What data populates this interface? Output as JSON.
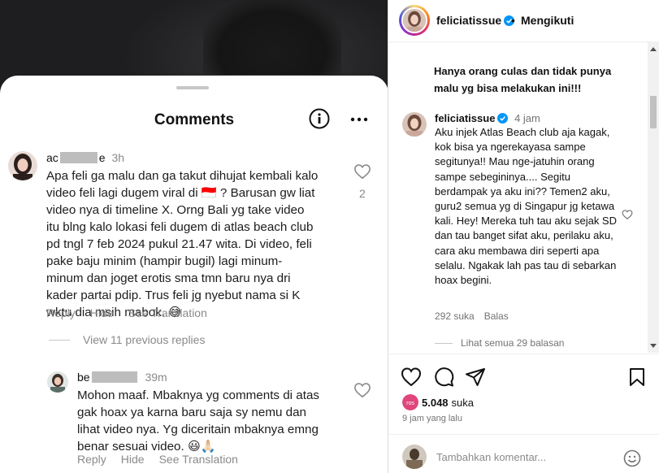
{
  "comments_sheet": {
    "title": "Comments",
    "comment1": {
      "user_prefix": "ac",
      "user_suffix": "e",
      "time": "3h",
      "text": "Apa feli ga malu dan ga takut dihujat kembali kalo\nvideo feli lagi dugem viral di 🇮🇩 ? Barusan gw liat\nvideo nya di timeline X. Orng Bali yg take video\nitu blng kalo lokasi feli dugem di atlas beach club\npd tngl 7 feb 2024 pukul 21.47 wita. Di video, feli\npake baju minim (hampir bugil) lagi minum-\nminum dan joget erotis sma tmn baru nya dri\nkader partai pdip. Trus feli jg nyebut nama si K\nwktu dia msih mabok. 😅",
      "likes": "2",
      "reply": "Reply",
      "hide": "Hide",
      "see_translation": "See Translation"
    },
    "view_replies": "View 11 previous replies",
    "comment2": {
      "user_prefix": "be",
      "user_suffix": "",
      "time": "39m",
      "text": "Mohon maaf. Mbaknya yg comments di atas\ngak hoax ya karna baru saja sy nemu dan\nlihat video nya. Yg diceritain mbaknya emng\nbenar sesuai video. 😃🙏🏻",
      "reply": "Reply",
      "hide": "Hide",
      "see_translation": "See Translation"
    }
  },
  "post": {
    "username": "feliciatissue",
    "separator": "•",
    "follow_status": "Mengikuti",
    "caption_tail": "Hanya orang culas dan tidak punya malu yg bisa melakukan ini!!!",
    "reply": {
      "username": "feliciatissue",
      "time": "4 jam",
      "text": "Aku injek Atlas Beach club aja kagak, kok bisa ya ngerekayasa sampe segitunya!! Mau nge-jatuhin orang sampe sebegininya.... Segitu berdampak ya aku ini?? Temen2 aku, guru2 semua yg di Singapur jg ketawa kali. Hey! Mereka tuh tau aku sejak SD dan tau banget sifat aku, perilaku aku, cara aku membawa diri seperti apa selalu. Ngakak lah pas tau di sebarkan hoax begini.",
      "likes": "292 suka",
      "reply_label": "Balas",
      "see_all": "Lihat semua 29 balasan"
    },
    "likes_count": "5.048",
    "likes_label": "suka",
    "likes_avatar_text": "ros",
    "posted_time": "9 jam yang lalu",
    "comment_placeholder": "Tambahkan komentar..."
  },
  "colors": {
    "verified": "#0095f6",
    "text": "#111111",
    "muted": "#737373"
  },
  "icons": [
    "info-icon",
    "more-icon",
    "heart-icon",
    "comment-icon",
    "share-icon",
    "bookmark-icon",
    "emoji-icon",
    "verified-icon"
  ]
}
